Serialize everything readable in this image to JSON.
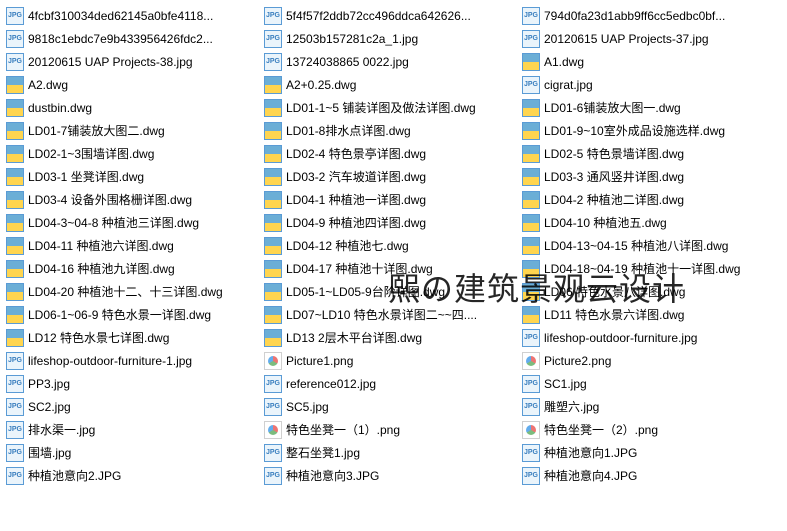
{
  "watermark": "熙の建筑景观云设计",
  "files": [
    {
      "name": "4fcbf310034ded62145a0bfe4118...",
      "type": "jpg"
    },
    {
      "name": "5f4f57f2ddb72cc496ddca642626...",
      "type": "jpg"
    },
    {
      "name": "794d0fa23d1abb9ff6cc5edbc0bf...",
      "type": "jpg"
    },
    {
      "name": "9818c1ebdc7e9b433956426fdc2...",
      "type": "jpg"
    },
    {
      "name": "12503b157281c2a_1.jpg",
      "type": "jpg"
    },
    {
      "name": "20120615 UAP Projects-37.jpg",
      "type": "jpg"
    },
    {
      "name": "20120615 UAP Projects-38.jpg",
      "type": "jpg"
    },
    {
      "name": "13724038865 0022.jpg",
      "type": "jpg"
    },
    {
      "name": "A1.dwg",
      "type": "dwg"
    },
    {
      "name": "A2.dwg",
      "type": "dwg"
    },
    {
      "name": "A2+0.25.dwg",
      "type": "dwg"
    },
    {
      "name": "cigrat.jpg",
      "type": "jpg"
    },
    {
      "name": "dustbin.dwg",
      "type": "dwg"
    },
    {
      "name": "LD01-1~5 铺装详图及做法详图.dwg",
      "type": "dwg"
    },
    {
      "name": "LD01-6铺装放大图一.dwg",
      "type": "dwg"
    },
    {
      "name": "LD01-7铺装放大图二.dwg",
      "type": "dwg"
    },
    {
      "name": "LD01-8排水点详图.dwg",
      "type": "dwg"
    },
    {
      "name": "LD01-9~10室外成品设施选样.dwg",
      "type": "dwg"
    },
    {
      "name": "LD02-1~3围墙详图.dwg",
      "type": "dwg"
    },
    {
      "name": "LD02-4 特色景亭详图.dwg",
      "type": "dwg"
    },
    {
      "name": "LD02-5 特色景墙详图.dwg",
      "type": "dwg"
    },
    {
      "name": "LD03-1 坐凳详图.dwg",
      "type": "dwg"
    },
    {
      "name": "LD03-2 汽车坡道详图.dwg",
      "type": "dwg"
    },
    {
      "name": "LD03-3 通风竖井详图.dwg",
      "type": "dwg"
    },
    {
      "name": "LD03-4 设备外围格栅详图.dwg",
      "type": "dwg"
    },
    {
      "name": "LD04-1 种植池一详图.dwg",
      "type": "dwg"
    },
    {
      "name": "LD04-2 种植池二详图.dwg",
      "type": "dwg"
    },
    {
      "name": "LD04-3~04-8 种植池三详图.dwg",
      "type": "dwg"
    },
    {
      "name": "LD04-9 种植池四详图.dwg",
      "type": "dwg"
    },
    {
      "name": "LD04-10 种植池五.dwg",
      "type": "dwg"
    },
    {
      "name": "LD04-11 种植池六详图.dwg",
      "type": "dwg"
    },
    {
      "name": "LD04-12 种植池七.dwg",
      "type": "dwg"
    },
    {
      "name": "LD04-13~04-15 种植池八详图.dwg",
      "type": "dwg"
    },
    {
      "name": "LD04-16 种植池九详图.dwg",
      "type": "dwg"
    },
    {
      "name": "LD04-17 种植池十详图.dwg",
      "type": "dwg"
    },
    {
      "name": "LD04-18~04-19 种植池十一详图.dwg",
      "type": "dwg"
    },
    {
      "name": "LD04-20 种植池十二、十三详图.dwg",
      "type": "dwg"
    },
    {
      "name": "LD05-1~LD05-9台阶详图.dwg",
      "type": "dwg"
    },
    {
      "name": "LD06 特色水景八详图.dwg",
      "type": "dwg"
    },
    {
      "name": "LD06-1~06-9 特色水景一详图.dwg",
      "type": "dwg"
    },
    {
      "name": "LD07~LD10 特色水景详图二~~四....",
      "type": "dwg"
    },
    {
      "name": "LD11 特色水景六详图.dwg",
      "type": "dwg"
    },
    {
      "name": "LD12 特色水景七详图.dwg",
      "type": "dwg"
    },
    {
      "name": "LD13 2层木平台详图.dwg",
      "type": "dwg"
    },
    {
      "name": "lifeshop-outdoor-furniture.jpg",
      "type": "jpg"
    },
    {
      "name": "lifeshop-outdoor-furniture-1.jpg",
      "type": "jpg"
    },
    {
      "name": "Picture1.png",
      "type": "png"
    },
    {
      "name": "Picture2.png",
      "type": "png"
    },
    {
      "name": "PP3.jpg",
      "type": "jpg"
    },
    {
      "name": "reference012.jpg",
      "type": "jpg"
    },
    {
      "name": "SC1.jpg",
      "type": "jpg"
    },
    {
      "name": "SC2.jpg",
      "type": "jpg"
    },
    {
      "name": "SC5.jpg",
      "type": "jpg"
    },
    {
      "name": "雕塑六.jpg",
      "type": "jpg"
    },
    {
      "name": "排水渠一.jpg",
      "type": "jpg"
    },
    {
      "name": "特色坐凳一（1）.png",
      "type": "png"
    },
    {
      "name": "特色坐凳一（2）.png",
      "type": "png"
    },
    {
      "name": "围墙.jpg",
      "type": "jpg"
    },
    {
      "name": "整石坐凳1.jpg",
      "type": "jpg"
    },
    {
      "name": "种植池意向1.JPG",
      "type": "jpg"
    },
    {
      "name": "种植池意向2.JPG",
      "type": "jpg"
    },
    {
      "name": "种植池意向3.JPG",
      "type": "jpg"
    },
    {
      "name": "种植池意向4.JPG",
      "type": "jpg"
    }
  ]
}
